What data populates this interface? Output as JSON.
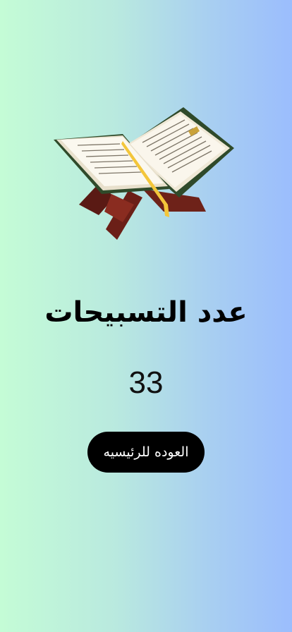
{
  "page": {
    "title": "عدد التسبيحات",
    "count": "33",
    "home_button_label": "العوده للرئيسيه"
  },
  "hero": {
    "icon": "quran-on-stand-icon"
  },
  "colors": {
    "gradient_start": "#c4fcd6",
    "gradient_end": "#9bbdfd",
    "button_bg": "#000000",
    "button_text": "#ffffff"
  }
}
